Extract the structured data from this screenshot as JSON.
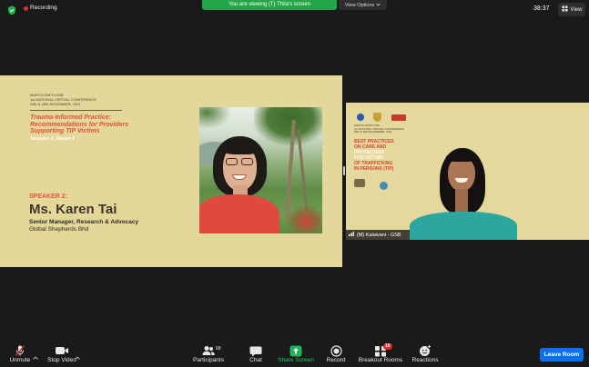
{
  "top_bar": {
    "recording_label": "Recording",
    "viewing_banner": "You are viewing (T) Thila's screen",
    "view_options_label": "View Options",
    "timer": "38:37",
    "view_label": "View",
    "icons": {
      "security": "shield-icon",
      "recording": "recording-dot-icon",
      "view_options": "chevron-down-icon",
      "view": "grid-icon"
    }
  },
  "shared_slide": {
    "conference_lines": [
      "MAPCG-PAPO-GSB",
      "1st NATIONAL VIRTUAL CONFERENCE",
      "25th & 26th NOVEMBER, 2021"
    ],
    "title_lines": [
      "Trauma-Informed Practice:",
      "Recommendations for Providers",
      "Supporting TIP Victims"
    ],
    "session": "Session 2, Room 1",
    "speaker_label": "SPEAKER 2:",
    "speaker_name": "Ms. Karen Tai",
    "speaker_title": "Senior Manager, Research & Advocacy",
    "speaker_org": "Global Shepherds Bhd"
  },
  "participant_tile": {
    "name": "(M) Kalaivani - GSB",
    "background_conference_lines": [
      "MAPCG-PAPO-GSB",
      "1st NATIONAL VIRTUAL CONFERENCE",
      "25th & 26th NOVEMBER, 2021"
    ],
    "background_title_lines": [
      "BEST PRACTICES",
      "ON CARE AND",
      "PROTECTION",
      "FOR VICTIMS",
      "OF TRAFFICKING",
      "IN PERSONS (TIP)"
    ],
    "icons": {
      "signal": "signal-bars-icon"
    }
  },
  "toolbar": {
    "unmute_label": "Unmute",
    "stop_video_label": "Stop Video",
    "participants_label": "Participants",
    "participants_count": "68",
    "chat_label": "Chat",
    "share_screen_label": "Share Screen",
    "record_label": "Record",
    "breakout_rooms_label": "Breakout Rooms",
    "breakout_rooms_badge": "10",
    "reactions_label": "Reactions",
    "leave_label": "Leave Room",
    "icons": {
      "unmute": "mic-muted-icon",
      "stop_video": "camera-icon",
      "participants": "participants-icon",
      "chat": "chat-icon",
      "share_screen": "share-screen-icon",
      "record": "record-icon",
      "breakout_rooms": "breakout-rooms-icon",
      "reactions": "reactions-icon",
      "options": "chevron-up-icon"
    }
  },
  "colors": {
    "app_background": "#1a1a1a",
    "viewing_banner_green": "#25a549",
    "recording_red": "#e5302c",
    "leave_button_blue": "#0e71eb",
    "share_screen_green": "#27c463",
    "slide_background": "#e3d79a",
    "slide_title_red": "#e3513a"
  }
}
